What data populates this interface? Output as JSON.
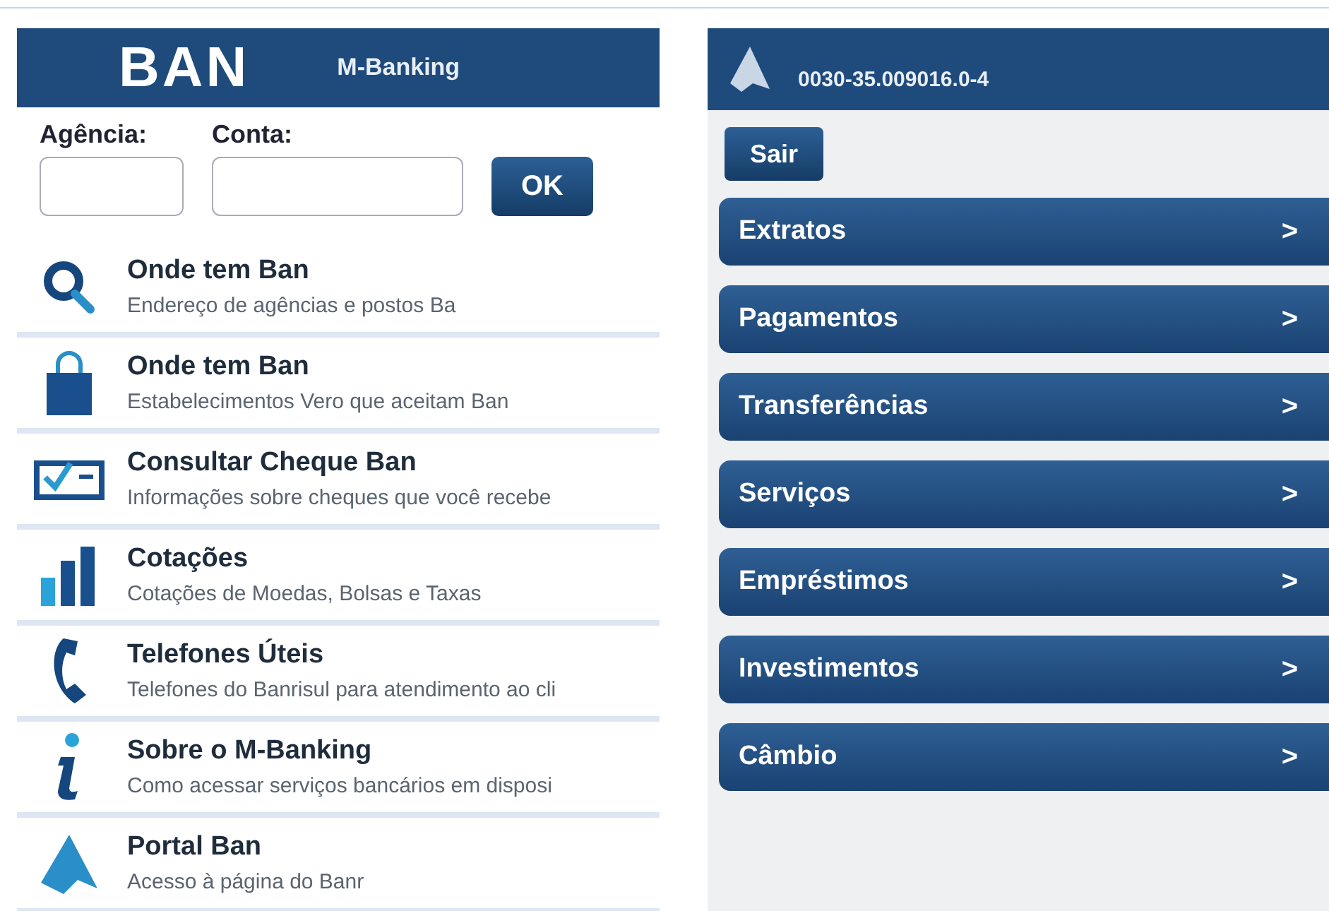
{
  "login_screen": {
    "logo": "BAN",
    "title": "M-Banking",
    "fields": [
      {
        "label": "Agência:"
      },
      {
        "label": "Conta:"
      }
    ],
    "button": "OK",
    "items": [
      {
        "kind": "search",
        "title": "Onde tem Ban",
        "subtitle": "Endereço de agências e postos Ba"
      },
      {
        "kind": "bag",
        "title": "Onde tem Ban",
        "subtitle": "Estabelecimentos Vero que aceitam Ban"
      },
      {
        "kind": "cheque",
        "title": "Consultar Cheque Ban",
        "subtitle": "Informações sobre cheques que você recebe"
      },
      {
        "kind": "bars",
        "title": "Cotações",
        "subtitle": "Cotações de Moedas, Bolsas e Taxas"
      },
      {
        "kind": "phone",
        "title": "Telefones Úteis",
        "subtitle": "Telefones do Banrisul para atendimento ao cli"
      },
      {
        "kind": "info",
        "title": "Sobre o M-Banking",
        "subtitle": "Como acessar serviços bancários em disposi"
      },
      {
        "kind": "logo",
        "title": "Portal Ban",
        "subtitle": "Acesso à página do Banr"
      }
    ]
  },
  "account_screen": {
    "account": "0030-35.009016.0-4",
    "exit_button": "Sair",
    "menu": [
      {
        "label": "Extratos",
        "chevron": ">"
      },
      {
        "label": "Pagamentos",
        "chevron": ">"
      },
      {
        "label": "Transferências",
        "chevron": ">"
      },
      {
        "label": "Serviços",
        "chevron": ">"
      },
      {
        "label": "Empréstimos",
        "chevron": ">"
      },
      {
        "label": "Investimentos",
        "chevron": ">"
      },
      {
        "label": "Câmbio",
        "chevron": ">"
      }
    ]
  }
}
